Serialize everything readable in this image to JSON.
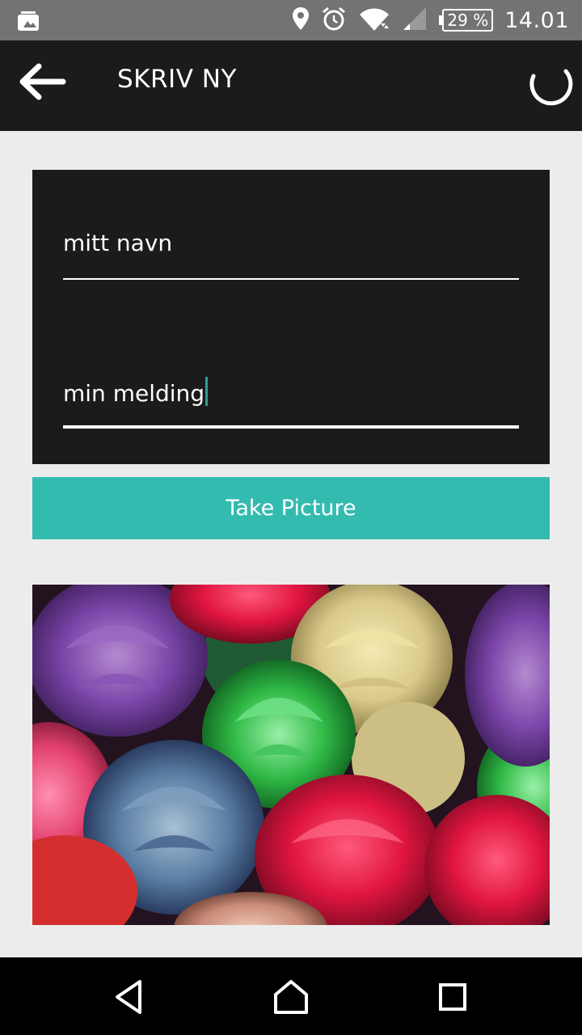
{
  "status_bar": {
    "icons": [
      "photo-notification-icon",
      "location-icon",
      "alarm-icon",
      "wifi-icon",
      "signal-icon",
      "battery-icon"
    ],
    "battery_label": "29 %",
    "time": "14.01",
    "background_color": "#737373"
  },
  "app_bar": {
    "title": "SKRIV NY",
    "back_icon": "arrow-left-icon",
    "loading_icon": "spinner-icon",
    "background_color": "#1b1b1b"
  },
  "form": {
    "name_value": "mitt navn",
    "message_value": "min melding"
  },
  "take_picture_button": {
    "label": "Take Picture",
    "color": "#34bbb0"
  },
  "photo": {
    "icon": "image-preview"
  },
  "nav_bar": {
    "icons": [
      "back-triangle-icon",
      "home-icon",
      "recents-icon"
    ]
  }
}
